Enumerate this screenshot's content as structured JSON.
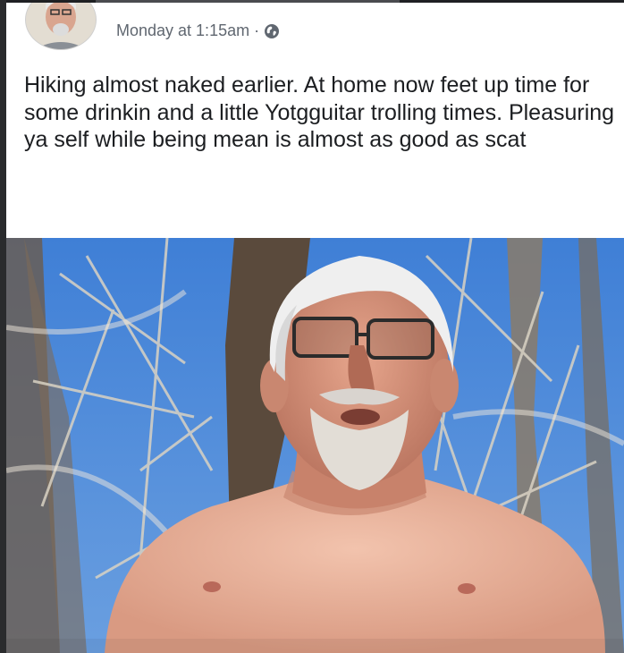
{
  "post": {
    "author_name": "",
    "timestamp": "Monday at 1:15am",
    "separator": "·",
    "privacy_icon": "globe-icon",
    "text": "Hiking almost naked earlier. At home now feet up time for some drinkin and a little Yotgguitar trolling times. Pleasuring ya self while being mean is almost as good as scat"
  },
  "colors": {
    "frame_dark": "#2a2b2d",
    "meta_gray": "#606770",
    "text_dark": "#1c1e21",
    "sky_blue": "#3a7bd8"
  }
}
